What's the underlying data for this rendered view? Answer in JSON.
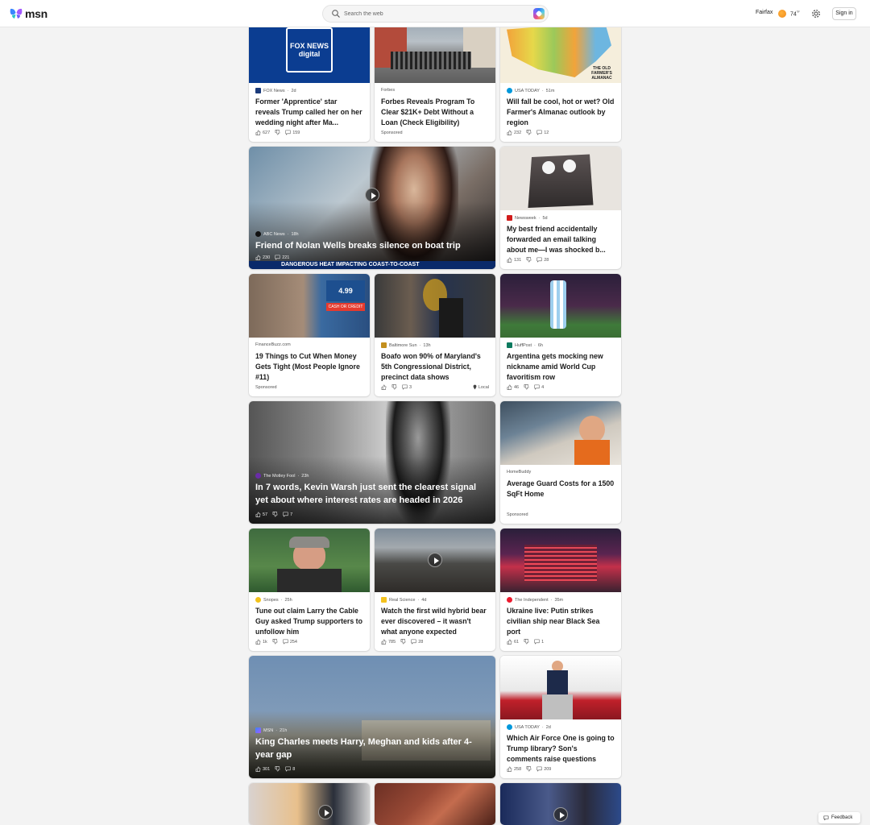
{
  "header": {
    "logo_text": "msn",
    "search_placeholder": "Search the web",
    "location": "Fairfax",
    "temperature": "74",
    "temp_unit": "°F",
    "sign_in": "Sign in"
  },
  "cards": {
    "fox": {
      "source": "FOX News",
      "time": "2d",
      "title": "Former 'Apprentice' star reveals Trump called her on her wedding night after Ma...",
      "likes": "627",
      "comments": "159",
      "thumb_text": "FOX NEWS digital"
    },
    "forbes": {
      "source": "Forbes",
      "title": "Forbes Reveals Program To Clear $21K+ Debt Without a Loan (Check Eligibility)",
      "sponsored": "Sponsored"
    },
    "usatoday1": {
      "source": "USA TODAY",
      "time": "51m",
      "title": "Will fall be cool, hot or wet? Old Farmer's Almanac outlook by region",
      "likes": "232",
      "comments": "12",
      "thumb_text": "THE OLD FARMER'S ALMANAC"
    },
    "abc": {
      "source": "ABC News",
      "time": "18h",
      "title": "Friend of Nolan Wells breaks silence on boat trip",
      "likes": "230",
      "comments": "221",
      "chyron": "DANGEROUS HEAT IMPACTING COAST-TO-COAST"
    },
    "newsweek": {
      "source": "Newsweek",
      "time": "5d",
      "title": "My best friend accidentally forwarded an email talking about me—I was shocked b...",
      "likes": "131",
      "comments": "28"
    },
    "financebuzz": {
      "source": "FinanceBuzz.com",
      "title": "19 Things to Cut When Money Gets Tight (Most People Ignore #11)",
      "sponsored": "Sponsored",
      "price_sign": "4.99",
      "sign_text": "CASH OR CREDIT"
    },
    "baltimore": {
      "source": "Baltimore Sun",
      "time": "13h",
      "title": "Boafo won 90% of Maryland's 5th Congressional District, precinct data shows",
      "comments": "3",
      "local": "Local"
    },
    "huffpost": {
      "source": "HuffPost",
      "time": "6h",
      "title": "Argentina gets mocking new nickname amid World Cup favoritism row",
      "likes": "46",
      "comments": "4"
    },
    "fool": {
      "source": "The Motley Fool",
      "time": "23h",
      "title": "In 7 words, Kevin Warsh just sent the clearest signal yet about where interest rates are headed in 2026",
      "likes": "57",
      "comments": "7"
    },
    "homebuddy": {
      "source": "HomeBuddy",
      "title": "Average Guard Costs for a 1500 SqFt Home",
      "sponsored": "Sponsored"
    },
    "snopes": {
      "source": "Snopes",
      "time": "25h",
      "title": "Tune out claim Larry the Cable Guy asked Trump supporters to unfollow him",
      "likes": "1k",
      "comments": "254"
    },
    "realscience": {
      "source": "Real Science",
      "time": "4d",
      "title": "Watch the first wild hybrid bear ever discovered – it wasn't what anyone expected",
      "likes": "785",
      "comments": "28"
    },
    "independent": {
      "source": "The Independent",
      "time": "35m",
      "title": "Ukraine live: Putin strikes civilian ship near Black Sea port",
      "likes": "61",
      "comments": "1"
    },
    "msn": {
      "source": "MSN",
      "time": "21h",
      "title": "King Charles meets Harry, Meghan and kids after 4-year gap",
      "likes": "301",
      "comments": "8"
    },
    "usatoday2": {
      "source": "USA TODAY",
      "time": "2d",
      "title": "Which Air Force One is going to Trump library? Son's comments raise questions",
      "likes": "258",
      "comments": "209"
    }
  },
  "footer": {
    "feedback": "Feedback"
  },
  "colors": {
    "accent": "#0f6cbd",
    "background": "#f3f3f3"
  }
}
